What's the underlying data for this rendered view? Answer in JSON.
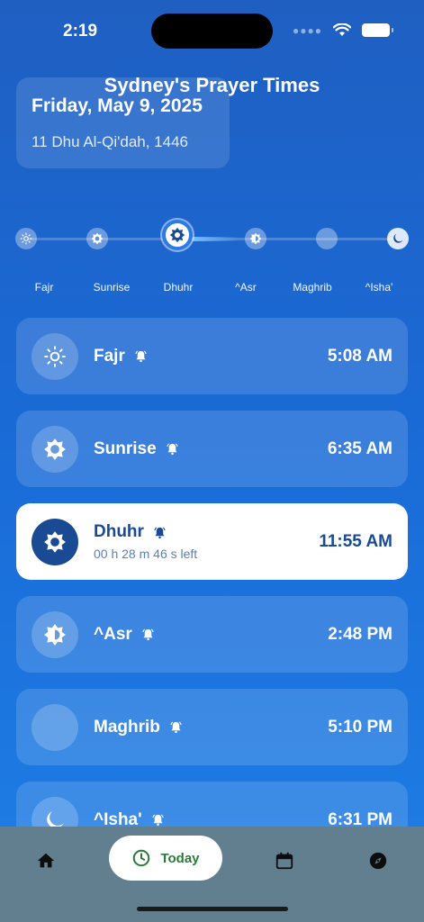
{
  "status": {
    "time": "2:19"
  },
  "header": {
    "title": "Sydney's Prayer Times",
    "gregorian_date": "Friday, May 9, 2025",
    "hijri_date": "11 Dhu Al-Qi'dah, 1446"
  },
  "timeline": {
    "labels": [
      "Fajr",
      "Sunrise",
      "Dhuhr",
      "^Asr",
      "Maghrib",
      "^Isha'"
    ],
    "current_index": 2
  },
  "prayers": [
    {
      "name": "Fajr",
      "time": "5:08 AM",
      "icon": "sun-outline-icon"
    },
    {
      "name": "Sunrise",
      "time": "6:35 AM",
      "icon": "sun-icon"
    },
    {
      "name": "Dhuhr",
      "time": "11:55 AM",
      "icon": "sun-icon",
      "countdown": "00 h 28 m 46 s left"
    },
    {
      "name": "^Asr",
      "time": "2:48 PM",
      "icon": "half-sun-icon"
    },
    {
      "name": "Maghrib",
      "time": "5:10 PM",
      "icon": "crescent-icon"
    },
    {
      "name": "^Isha'",
      "time": "6:31 PM",
      "icon": "moon-night-icon"
    }
  ],
  "tabs": {
    "today_label": "Today"
  },
  "colors": {
    "accent": "#1b4a94",
    "tab_active_text": "#2a7a3a",
    "tab_bar": "#627f90"
  }
}
